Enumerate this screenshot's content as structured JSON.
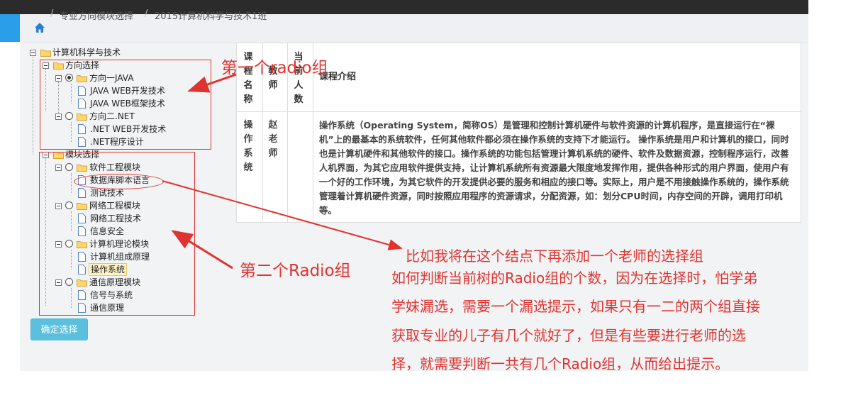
{
  "breadcrumb": {
    "home_icon": "home-icon",
    "items": [
      "专业方向模块选择",
      "2015计算机科学与技术1班"
    ]
  },
  "tree": {
    "root": "计算机科学与技术",
    "group1": {
      "label": "方向选择",
      "options": [
        {
          "label": "方向一JAVA",
          "checked": true,
          "children": [
            "JAVA WEB开发技术",
            "JAVA WEB框架技术"
          ]
        },
        {
          "label": "方向二.NET",
          "checked": false,
          "children": [
            ".NET WEB开发技术",
            ".NET程序设计"
          ]
        }
      ]
    },
    "group2": {
      "label": "模块选择",
      "options": [
        {
          "label": "软件工程模块",
          "checked": false,
          "children": [
            "数据库脚本语言",
            "测试技术"
          ]
        },
        {
          "label": "网络工程模块",
          "checked": false,
          "children": [
            "网络工程技术",
            "信息安全"
          ]
        },
        {
          "label": "计算机理论模块",
          "checked": false,
          "children": [
            "计算机组成原理",
            "操作系统"
          ]
        },
        {
          "label": "通信原理模块",
          "checked": false,
          "children": [
            "信号与系统",
            "通信原理"
          ]
        }
      ]
    }
  },
  "confirm_button": "确定选择",
  "table": {
    "headers": [
      "课程名称",
      "教师",
      "当前人数",
      "课程介绍"
    ],
    "row": {
      "course": "操作系统",
      "teacher": "赵老师",
      "count": "",
      "intro": "操作系统（Operating System，简称OS）是管理和控制计算机硬件与软件资源的计算机程序，是直接运行在“裸机”上的最基本的系统软件，任何其他软件都必须在操作系统的支持下才能运行。 操作系统是用户和计算机的接口，同时也是计算机硬件和其他软件的接口。操作系统的功能包括管理计算机系统的硬件、软件及数据资源，控制程序运行，改善人机界面，为其它应用软件提供支持，让计算机系统所有资源最大限度地发挥作用，提供各种形式的用户界面，使用户有一个好的工作环境，为其它软件的开发提供必要的服务和相应的接口等。实际上，用户是不用接触操作系统的，操作系统管理着计算机硬件资源，同时按照应用程序的资源请求，分配资源，如：划分CPU时间，内存空间的开辟，调用打印机等。"
    }
  },
  "annotations": {
    "group1": "第一个radio组",
    "group2": "第二个Radio组",
    "add_node": "比如我将在这个结点下再添加一个老师的选择组",
    "question": [
      "如何判断当前树的Radio组的个数，因为在选择时，怕学弟",
      "学妹漏选，需要一个漏选提示，如果只有一二的两个组直接",
      "获取专业的儿子有几个就好了，但是有些要进行老师的选",
      "择，就需要判断一共有几个Radio组，从而给出提示。"
    ]
  },
  "colors": {
    "annotation_red": "#e0332f",
    "button_blue": "#5bc0de",
    "top_bar": "#2b2b2b",
    "side_tab_blue": "#2a9ee8"
  }
}
